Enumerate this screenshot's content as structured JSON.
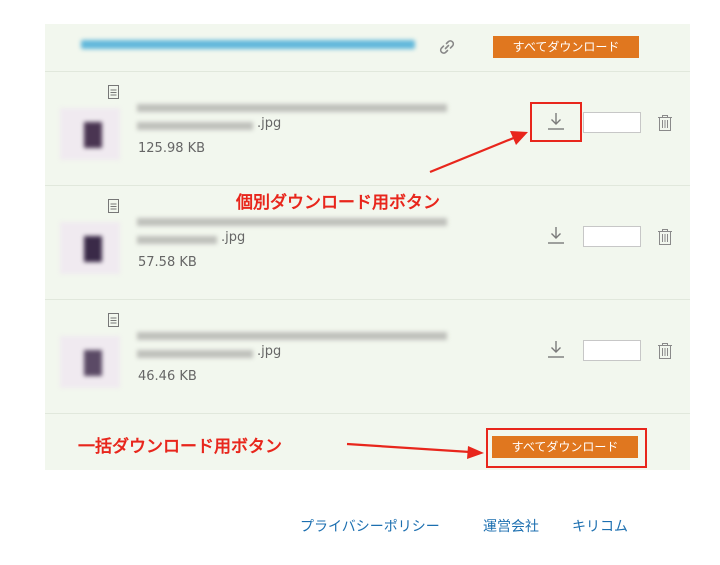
{
  "header": {
    "download_all_label": "すべてダウンロード"
  },
  "files": [
    {
      "ext": ".jpg",
      "size": "125.98 KB"
    },
    {
      "ext": ".jpg",
      "size": "57.58 KB"
    },
    {
      "ext": ".jpg",
      "size": "46.46 KB"
    }
  ],
  "bottom": {
    "download_all_label": "すべてダウンロード"
  },
  "annotations": {
    "individual": "個別ダウンロード用ボタン",
    "bulk": "一括ダウンロード用ボタン"
  },
  "footer": {
    "links": [
      "プライバシーポリシー",
      "運営会社",
      "キリコム"
    ]
  },
  "colors": {
    "accent": "#e0771f",
    "annotation": "#e8261c",
    "panel_bg": "#f2f7ee",
    "link": "#1c6fb0"
  }
}
